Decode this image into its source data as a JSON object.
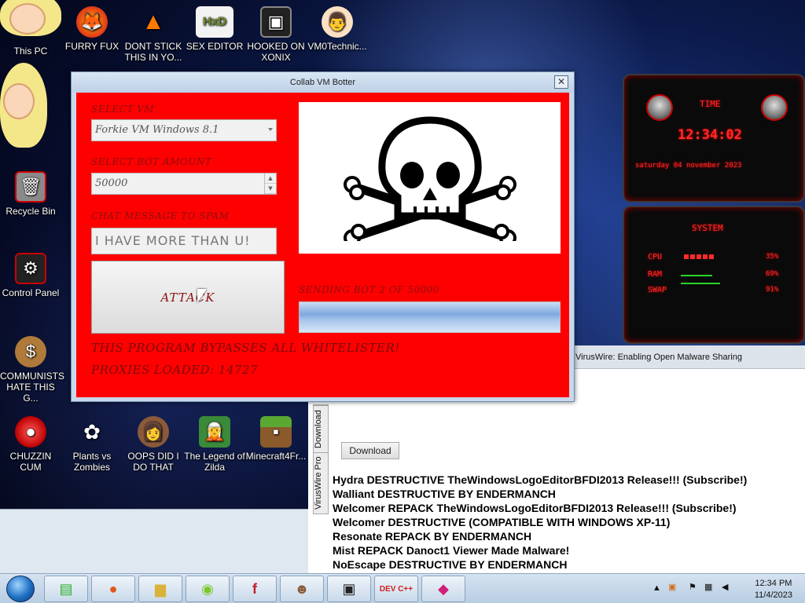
{
  "desktop": {
    "icons": [
      {
        "label": "This PC"
      },
      {
        "label": "FURRY FUX"
      },
      {
        "label": "DONT STICK THIS IN YO..."
      },
      {
        "label": "SEX EDITOR"
      },
      {
        "label": "HOOKED ON XONIX"
      },
      {
        "label": "VM0Technic..."
      },
      {
        "label": "Recycle Bin"
      },
      {
        "label": "Control Panel"
      },
      {
        "label": "COMMUNISTS HATE THIS G..."
      },
      {
        "label": "CHUZZIN CUM"
      },
      {
        "label": "Plants vs Zombies"
      },
      {
        "label": "OOPS DID I DO THAT"
      },
      {
        "label": "The Legend of Zilda"
      },
      {
        "label": "Minecraft4Fr..."
      }
    ]
  },
  "dialog": {
    "title": "Collab VM Botter",
    "close_label": "✕",
    "select_vm_label": "SELECT VM",
    "select_vm_value": "Forkie VM Windows 8.1",
    "bot_amount_label": "SELECT BOT AMOUNT",
    "bot_amount_value": "50000",
    "chat_label": "CHAT MESSAGE TO SPAM",
    "chat_value": "I HAVE MORE THAN U!",
    "attack_label": "ATTACK",
    "status_label": "SENDING BOT 2 OF 50000",
    "progress": 1.0,
    "bypass_text": "THIS PROGRAM BYPASSES ALL WHITELISTER!",
    "proxies_text": "PROXIES LOADED: 14727"
  },
  "widget": {
    "time_title": "TIME",
    "time_value": "12:34:02",
    "date_value": "saturday 04 november 2023",
    "system_title": "SYSTEM",
    "rows": [
      {
        "label": "CPU",
        "value": "35%"
      },
      {
        "label": "RAM",
        "value": "69%"
      },
      {
        "label": "SWAP",
        "value": "91%"
      }
    ]
  },
  "viruswire": {
    "title": "VirusWire: Enabling Open Malware Sharing",
    "tabs": [
      "Download",
      "VirusWire Pro"
    ],
    "download_button": "Download",
    "items": [
      "Hydra DESTRUCTIVE TheWindowsLogoEditorBFDI2013 Release!!! (Subscribe!)",
      "Walliant DESTRUCTIVE BY ENDERMANCH",
      "Welcomer REPACK TheWindowsLogoEditorBFDI2013 Release!!! (Subscribe!)",
      "Welcomer DESTRUCTIVE (COMPATIBLE WITH WINDOWS XP-11)",
      "Resonate REPACK BY ENDERMANCH",
      "Mist REPACK Danoct1 Viewer Made Malware!",
      "NoEscape DESTRUCTIVE BY ENDERMANCH"
    ]
  },
  "taskbar": {
    "clock_time": "12:34 PM",
    "clock_date": "11/4/2023"
  },
  "colors": {
    "dialog_bg": "#ff0000",
    "label_text": "#8a1010",
    "taskbar": "#c8d8ea"
  }
}
